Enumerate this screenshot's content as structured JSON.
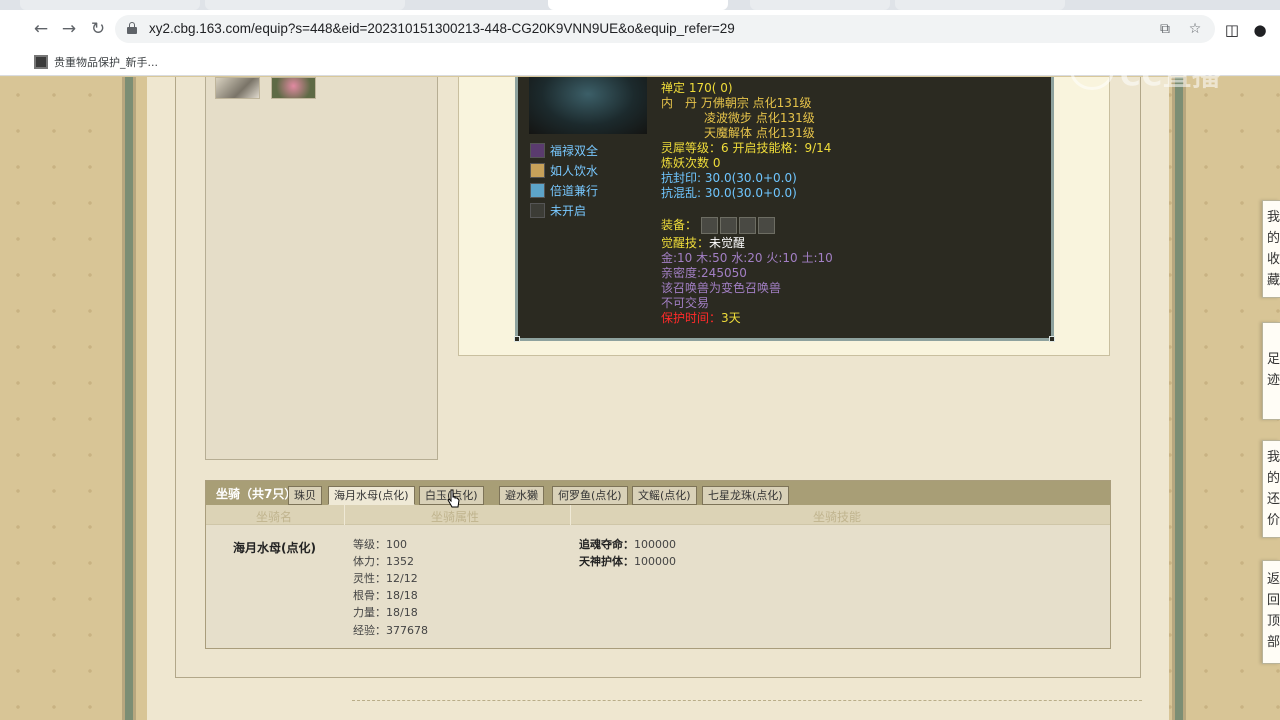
{
  "browser": {
    "url": "xy2.cbg.163.com/equip?s=448&eid=202310151300213-448-CG20K9VNN9UE&o&equip_refer=29",
    "bookmark_label": "贵重物品保护_新手..."
  },
  "pet": {
    "lines": [
      {
        "text": "禅定 170( 0)"
      },
      {
        "text": "内　丹 万佛朝宗 点化131级"
      },
      {
        "text": "凌波微步 点化131级"
      },
      {
        "text": "天魔解体 点化131级"
      },
      {
        "label": "灵犀等级：",
        "value": "6 开启技能格：9/14"
      },
      {
        "text": "炼妖次数 0"
      },
      {
        "text": "抗封印: 30.0(30.0+0.0)"
      },
      {
        "text": "抗混乱: 30.0(30.0+0.0)"
      },
      {
        "label": "装备："
      },
      {
        "label": "觉醒技：",
        "value": "未觉醒"
      },
      {
        "text": "金:10 木:50 水:20 火:10 土:10"
      },
      {
        "text": "亲密度:245050"
      },
      {
        "text": "该召唤兽为变色召唤兽"
      },
      {
        "text": "不可交易"
      },
      {
        "label": "保护时间：",
        "value": "3天"
      }
    ],
    "skills": [
      "福禄双全",
      "如人饮水",
      "倍道兼行",
      "未开启"
    ],
    "colors": {
      "yellow": "#f0dd3a",
      "cyan": "#6fc6ff",
      "purple": "#a27fc4",
      "red": "#ff2a2a"
    }
  },
  "mount": {
    "title": "坐骑（共7只）",
    "tabs": [
      "珠贝",
      "海月水母(点化)",
      "白玉(点化)",
      "避水獭",
      "何罗鱼(点化)",
      "文鳐(点化)",
      "七星龙珠(点化)"
    ],
    "active_tab": "海月水母(点化)",
    "columns": [
      "坐骑名",
      "坐骑属性",
      "坐骑技能"
    ],
    "name": "海月水母(点化)",
    "attributes": [
      {
        "label": "等级：",
        "value": "100"
      },
      {
        "label": "体力：",
        "value": "1352"
      },
      {
        "label": "灵性：",
        "value": "12/12"
      },
      {
        "label": "根骨：",
        "value": "18/18"
      },
      {
        "label": "力量：",
        "value": "18/18"
      },
      {
        "label": "经验：",
        "value": "377678"
      }
    ],
    "skills": [
      {
        "label": "追魂夺命：",
        "value": "100000"
      },
      {
        "label": "天神护体：",
        "value": "100000"
      }
    ]
  },
  "side_tabs": [
    {
      "text": "我的收藏"
    },
    {
      "text": "足迹"
    },
    {
      "text": "我的还价"
    },
    {
      "text": "返回顶部"
    }
  ],
  "watermark": "CC直播"
}
